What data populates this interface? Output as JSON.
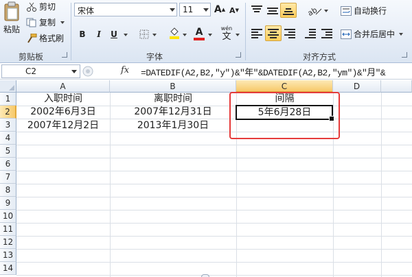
{
  "ribbon": {
    "clipboard": {
      "paste": "粘贴",
      "cut": "剪切",
      "copy": "复制",
      "format_painter": "格式刷",
      "group": "剪贴板"
    },
    "font": {
      "name": "宋体",
      "size": "11",
      "bold": "B",
      "italic": "I",
      "underline": "U",
      "grow": "A",
      "shrink": "A",
      "font_color_letter": "A",
      "wen": "wén",
      "wen_char": "文",
      "group": "字体"
    },
    "alignment": {
      "wrap_text": "自动换行",
      "merge_center": "合并后居中",
      "group": "对齐方式"
    }
  },
  "formula_bar": {
    "name_box": "C2",
    "fx": "fx",
    "formula": "=DATEDIF(A2,B2,\"y\")&\"年\"&DATEDIF(A2,B2,\"ym\")&\"月\"&"
  },
  "grid": {
    "columns": [
      "A",
      "B",
      "C",
      "D"
    ],
    "rows": [
      "1",
      "2",
      "3",
      "4",
      "5",
      "6",
      "7",
      "8",
      "9",
      "10",
      "11",
      "12",
      "13",
      "14"
    ],
    "cells": {
      "A1": "入职时间",
      "B1": "离职时间",
      "C1": "间隔",
      "A2": "2002年6月3日",
      "B2": "2007年12月31日",
      "C2": "5年6月28日",
      "A3": "2007年12月2日",
      "B3": "2013年1月30日"
    }
  },
  "colors": {
    "highlight": "#e53a3a",
    "selected_header": "#f7c96a"
  }
}
